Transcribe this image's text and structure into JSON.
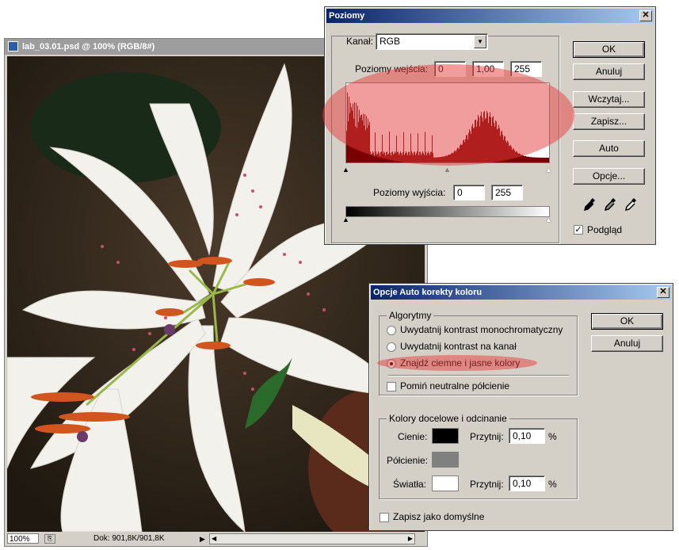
{
  "document": {
    "title": "lab_03.01.psd @ 100% (RGB/8#)",
    "zoom": "100%",
    "doc_info": "Dok: 901,8K/901,8K"
  },
  "levels": {
    "title": "Poziomy",
    "channel_label": "Kanał:",
    "channel_value": "RGB",
    "input_label": "Poziomy wejścia:",
    "input_black": "0",
    "input_gamma": "1,00",
    "input_white": "255",
    "output_label": "Poziomy wyjścia:",
    "output_black": "0",
    "output_white": "255",
    "buttons": {
      "ok": "OK",
      "cancel": "Anuluj",
      "load": "Wczytaj...",
      "save": "Zapisz...",
      "auto": "Auto",
      "options": "Opcje..."
    },
    "preview_label": "Podgląd",
    "preview_checked": true
  },
  "auto_options": {
    "title": "Opcje Auto korekty koloru",
    "algorithms_label": "Algorytmy",
    "algorithms": [
      {
        "label": "Uwydatnij kontrast monochromatyczny",
        "selected": false
      },
      {
        "label": "Uwydatnij kontrast na kanał",
        "selected": false
      },
      {
        "label": "Znajdź ciemne i jasne kolory",
        "selected": true
      }
    ],
    "snap_neutral_label": "Pomiń neutralne półcienie",
    "snap_neutral_checked": false,
    "targets_label": "Kolory docelowe i odcinanie",
    "shadows_label": "Cienie:",
    "shadows_color": "#000000",
    "midtones_label": "Półcienie:",
    "midtones_color": "#808080",
    "highlights_label": "Światła:",
    "highlights_color": "#ffffff",
    "clip_label": "Przytnij:",
    "shadows_clip": "0,10",
    "highlights_clip": "0,10",
    "percent": "%",
    "save_default_label": "Zapisz jako domyślne",
    "buttons": {
      "ok": "OK",
      "cancel": "Anuluj"
    }
  }
}
